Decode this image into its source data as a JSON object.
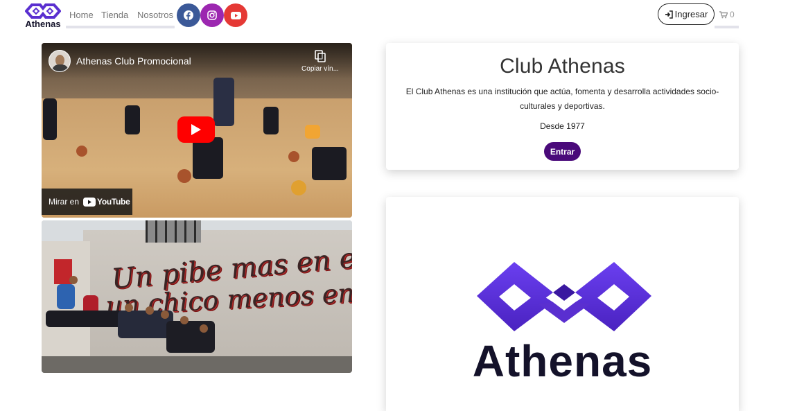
{
  "navbar": {
    "brand": "Athenas",
    "links": [
      {
        "label": "Home"
      },
      {
        "label": "Tienda"
      },
      {
        "label": "Nosotros"
      }
    ],
    "social": [
      {
        "name": "facebook",
        "color": "#3b5998"
      },
      {
        "name": "instagram",
        "color": "#9c27b0"
      },
      {
        "name": "youtube",
        "color": "#e53935"
      }
    ],
    "login_label": "Ingresar",
    "cart_count": "0"
  },
  "video": {
    "title": "Athenas Club Promocional",
    "copy_label": "Copiar vín...",
    "watch_label": "Mirar en",
    "youtube_label": "YouTube"
  },
  "mural": {
    "line1": "Un pibe mas en el club",
    "line2": "un chico menos en la calle"
  },
  "club_card": {
    "title": "Club Athenas",
    "description": "El Club Athenas es una institución que actúa, fomenta y desarrolla actividades socio-culturales y deportivas.",
    "since": "Desde 1977",
    "enter_label": "Entrar"
  },
  "logo_card": {
    "text": "Athenas"
  },
  "colors": {
    "brand_purple": "#5a2fd0",
    "enter_button": "#4a0a7a"
  }
}
